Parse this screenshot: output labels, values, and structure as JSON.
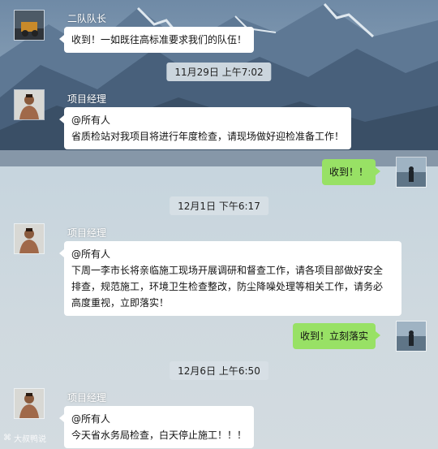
{
  "messages": [
    {
      "sender": "二队队长",
      "text": "收到！一如既往高标准要求我们的队伍！"
    },
    {
      "time": "11月29日 上午7:02"
    },
    {
      "sender": "项目经理",
      "lines": [
        "@所有人",
        "省质检站对我项目将进行年度检查，请现场做好迎检准备工作！"
      ]
    },
    {
      "text_me": "收到！！"
    },
    {
      "time": "12月1日 下午6:17"
    },
    {
      "sender": "项目经理",
      "lines": [
        "@所有人",
        "下周一李市长将亲临施工现场开展调研和督查工作，请各项目部做好安全",
        "排查，规范施工，环境卫生检查整改，防尘降噪处理等相关工作，请务必",
        "高度重视，立即落实！"
      ]
    },
    {
      "text_me": "收到！立刻落实"
    },
    {
      "time": "12月6日 上午6:50"
    },
    {
      "sender": "项目经理",
      "lines": [
        "@所有人",
        "今天省水务局检查，白天停止施工！！！"
      ]
    }
  ],
  "watermark": "大叔鸭说"
}
